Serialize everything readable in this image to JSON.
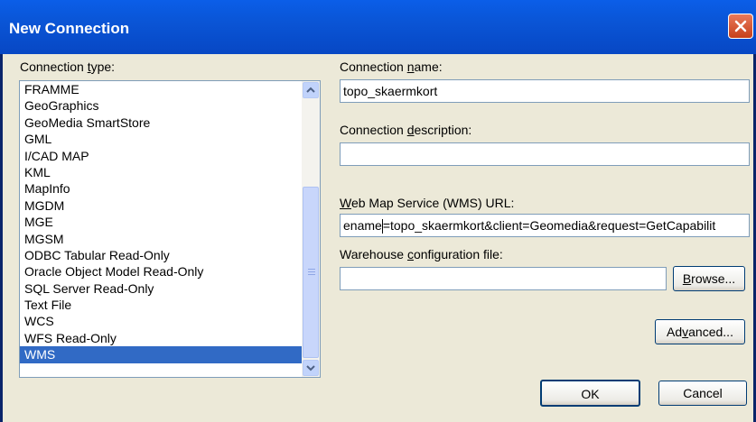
{
  "window": {
    "title": "New Connection"
  },
  "connection_type": {
    "label_pre": "Connection ",
    "label_accel": "t",
    "label_post": "ype:",
    "items": [
      "FRAMME",
      "GeoGraphics",
      "GeoMedia SmartStore",
      "GML",
      "I/CAD MAP",
      "KML",
      "MapInfo",
      "MGDM",
      "MGE",
      "MGSM",
      "ODBC Tabular Read-Only",
      "Oracle Object Model Read-Only",
      "SQL Server Read-Only",
      "Text File",
      "WCS",
      "WFS Read-Only",
      "WMS"
    ],
    "selected": "WMS"
  },
  "connection_name": {
    "label_pre": "Connection ",
    "label_accel": "n",
    "label_post": "ame:",
    "value": "topo_skaermkort"
  },
  "connection_description": {
    "label_pre": "Connection ",
    "label_accel": "d",
    "label_post": "escription:",
    "value": ""
  },
  "wms_url": {
    "label_accel": "W",
    "label_post": "eb Map Service (WMS) URL:",
    "value_before_caret": "ename",
    "value_after_caret": "=topo_skaermkort&client=Geomedia&request=GetCapabilit"
  },
  "warehouse": {
    "label_pre": "Warehouse ",
    "label_accel": "c",
    "label_post": "onfiguration file:",
    "value": ""
  },
  "buttons": {
    "browse": {
      "accel": "B",
      "rest": "rowse..."
    },
    "advanced": {
      "pre": "Ad",
      "accel": "v",
      "rest": "anced..."
    },
    "ok": "OK",
    "cancel": "Cancel"
  },
  "colors": {
    "selection": "#316ac5",
    "titlebar": "#0a55d6",
    "dialog": "#ece9d8"
  }
}
